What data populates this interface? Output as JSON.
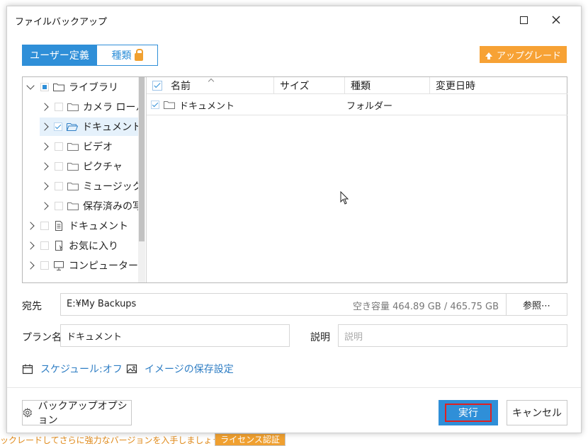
{
  "window": {
    "title": "ファイルバックアップ",
    "maximize_icon": "maximize-icon",
    "close_icon": "close-icon"
  },
  "tabs": {
    "user_defined": "ユーザー定義",
    "type": "種類",
    "lock_icon": "lock-icon"
  },
  "upgrade_label": "アップグレード",
  "tree": {
    "items": [
      {
        "label": "ライブラリ",
        "level": 0,
        "expanded": true,
        "check": "partial",
        "icon": "folder-icon"
      },
      {
        "label": "カメラ ロール",
        "level": 1,
        "expanded": false,
        "check": "none",
        "icon": "folder-icon"
      },
      {
        "label": "ドキュメント",
        "level": 1,
        "expanded": false,
        "check": "checked",
        "icon": "folder-icon",
        "selected": true
      },
      {
        "label": "ビデオ",
        "level": 1,
        "expanded": false,
        "check": "none",
        "icon": "folder-icon"
      },
      {
        "label": "ピクチャ",
        "level": 1,
        "expanded": false,
        "check": "none",
        "icon": "folder-icon"
      },
      {
        "label": "ミュージック",
        "level": 1,
        "expanded": false,
        "check": "none",
        "icon": "folder-icon"
      },
      {
        "label": "保存済みの写",
        "level": 1,
        "expanded": false,
        "check": "none",
        "icon": "folder-icon"
      },
      {
        "label": "ドキュメント",
        "level": 0,
        "expanded": false,
        "check": "none",
        "icon": "document-icon"
      },
      {
        "label": "お気に入り",
        "level": 0,
        "expanded": false,
        "check": "none",
        "icon": "favorites-icon"
      },
      {
        "label": "コンピューター",
        "level": 0,
        "expanded": false,
        "check": "none",
        "icon": "computer-icon"
      }
    ]
  },
  "list": {
    "columns": [
      "名前",
      "サイズ",
      "種類",
      "変更日時"
    ],
    "rows": [
      {
        "name": "ドキュメント",
        "size": "",
        "type": "フォルダー",
        "modified": "",
        "checked": true
      }
    ]
  },
  "destination": {
    "label": "宛先",
    "path": "E:¥My Backups",
    "free_space": "空き容量 464.89 GB / 465.75 GB",
    "browse_label": "参照⋯"
  },
  "plan": {
    "label": "プラン名",
    "value": "ドキュメント"
  },
  "description": {
    "label": "説明",
    "placeholder": "説明"
  },
  "links": {
    "schedule": "スケジュール:オフ",
    "image_settings": "イメージの保存設定"
  },
  "footer": {
    "options_label": "バックアップオプション",
    "run_label": "実行",
    "cancel_label": "キャンセル"
  },
  "background": {
    "notice": "ックレードしてさらに強力なバージョンを入手しましょう。",
    "license_button": "ライセンス認証"
  },
  "colors": {
    "accent": "#2f8fd8",
    "upgrade": "#f7a235",
    "highlight_border": "#e02020"
  }
}
